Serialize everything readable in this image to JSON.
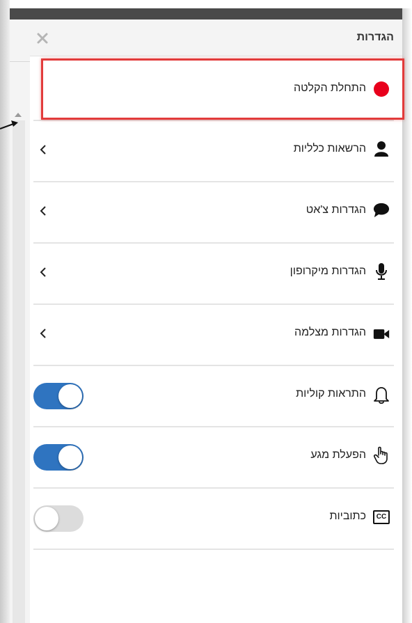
{
  "panel": {
    "title": "הגדרות",
    "close_label": "×"
  },
  "rows": [
    {
      "label": "התחלת הקלטה",
      "icon": "record-dot-icon",
      "control": "none"
    },
    {
      "label": "הרשאות כלליות",
      "icon": "user-icon",
      "control": "chevron"
    },
    {
      "label": "הגדרות צ'אט",
      "icon": "chat-bubble-icon",
      "control": "chevron"
    },
    {
      "label": "הגדרות מיקרופון",
      "icon": "microphone-icon",
      "control": "chevron"
    },
    {
      "label": "הגדרות מצלמה",
      "icon": "camera-icon",
      "control": "chevron"
    },
    {
      "label": "התראות קוליות",
      "icon": "bell-icon",
      "control": "toggle",
      "toggle_on": true
    },
    {
      "label": "הפעלת מגע",
      "icon": "touch-hand-icon",
      "control": "toggle",
      "toggle_on": true
    },
    {
      "label": "כתוביות",
      "icon": "closed-captions-icon",
      "control": "toggle",
      "toggle_on": false,
      "badge": "CC"
    }
  ],
  "colors": {
    "accent": "#2f74c0",
    "record": "#e8001c",
    "highlight": "#e23b3b",
    "toggle_off": "#dcdcdc"
  }
}
